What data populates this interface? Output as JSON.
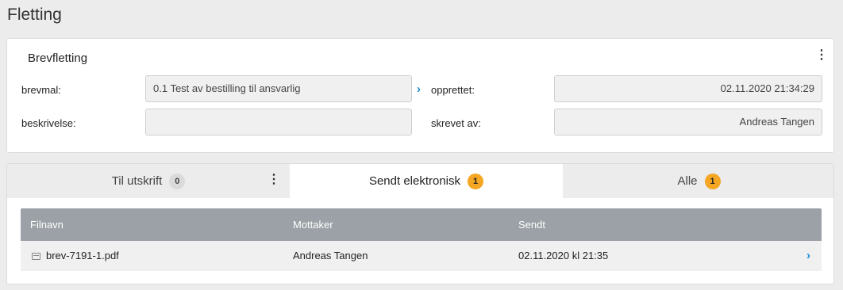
{
  "page": {
    "title": "Fletting"
  },
  "card": {
    "title": "Brevfletting",
    "fields": {
      "brevmal": {
        "label": "brevmal:",
        "value": "0.1 Test av bestilling til ansvarlig"
      },
      "beskrivelse": {
        "label": "beskrivelse:",
        "value": ""
      },
      "opprettet": {
        "label": "opprettet:",
        "value": "02.11.2020 21:34:29"
      },
      "skrevet_av": {
        "label": "skrevet av:",
        "value": "Andreas Tangen"
      }
    }
  },
  "tabs": [
    {
      "label": "Til utskrift",
      "count": "0",
      "active": false
    },
    {
      "label": "Sendt elektronisk",
      "count": "1",
      "active": true
    },
    {
      "label": "Alle",
      "count": "1",
      "active": false
    }
  ],
  "table": {
    "headers": {
      "filnavn": "Filnavn",
      "mottaker": "Mottaker",
      "sendt": "Sendt"
    },
    "rows": [
      {
        "filnavn": "brev-7191-1.pdf",
        "mottaker": "Andreas Tangen",
        "sendt": "02.11.2020 kl 21:35"
      }
    ]
  },
  "icons": {
    "kebab": "⋮",
    "chevron_right": "›",
    "file": "mail-file-icon"
  },
  "colors": {
    "accent_blue": "#1a8bd0",
    "badge_orange": "#f5a623",
    "table_header": "#9ba1a6"
  }
}
